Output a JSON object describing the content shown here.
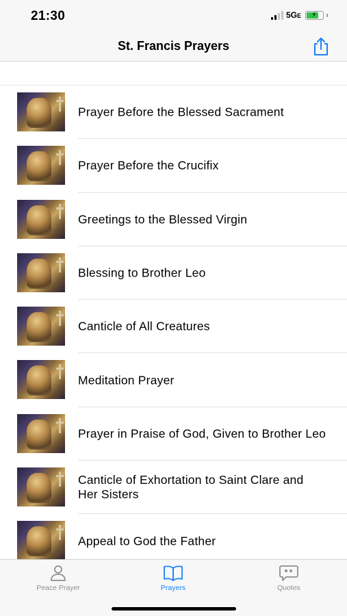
{
  "status_bar": {
    "time": "21:30",
    "network": "5G",
    "network_suffix": "E",
    "battery_color": "#33c24d"
  },
  "nav": {
    "title": "St. Francis Prayers",
    "share_icon": "share-icon",
    "accent": "#1a82f7"
  },
  "prayers": [
    {
      "title": "Prayer Before the Blessed Sacrament"
    },
    {
      "title": "Prayer Before the Crucifix"
    },
    {
      "title": "Greetings to the Blessed Virgin"
    },
    {
      "title": "Blessing to Brother Leo"
    },
    {
      "title": "Canticle of All Creatures"
    },
    {
      "title": "Meditation Prayer"
    },
    {
      "title": "Prayer in Praise of God, Given to Brother Leo"
    },
    {
      "title": "Canticle of Exhortation to Saint Clare and Her Sisters"
    },
    {
      "title": "Appeal to God the Father"
    }
  ],
  "tabs": [
    {
      "label": "Peace Prayer",
      "icon": "person-icon",
      "active": false
    },
    {
      "label": "Prayers",
      "icon": "book-icon",
      "active": true
    },
    {
      "label": "Quotes",
      "icon": "quote-bubble-icon",
      "active": false
    }
  ]
}
